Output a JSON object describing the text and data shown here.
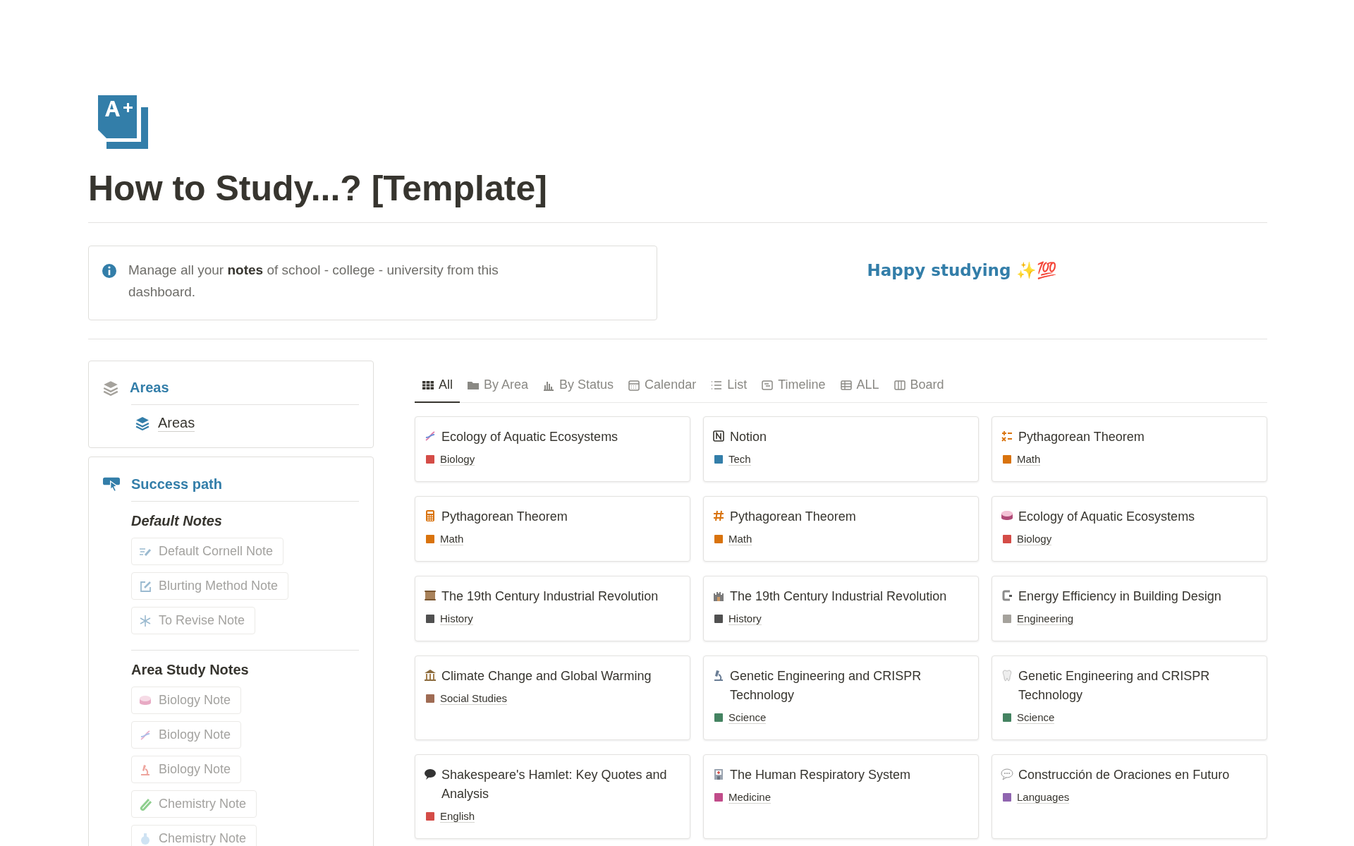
{
  "page": {
    "title": "How to Study...? [Template]"
  },
  "callout": {
    "text": "Manage all your **notes** of school - college - university from this dashboard."
  },
  "tagline": "Happy studying ✨💯",
  "areas_panel": {
    "title": "Areas",
    "items": [
      {
        "label": "Areas"
      }
    ]
  },
  "success_panel": {
    "title": "Success path",
    "sections": [
      {
        "heading": "Default Notes",
        "kind": "italic",
        "items": [
          {
            "label": "Default Cornell Note"
          },
          {
            "label": "Blurting Method Note"
          },
          {
            "label": "To Revise Note"
          }
        ]
      },
      {
        "heading": "Area Study Notes",
        "kind": "plain",
        "items": [
          {
            "label": "Biology Note"
          },
          {
            "label": "Biology Note"
          },
          {
            "label": "Biology Note"
          },
          {
            "label": "Chemistry Note"
          },
          {
            "label": "Chemistry Note"
          }
        ]
      }
    ]
  },
  "tabs": [
    {
      "label": "All",
      "selected": true
    },
    {
      "label": "By Area",
      "selected": false
    },
    {
      "label": "By Status",
      "selected": false
    },
    {
      "label": "Calendar",
      "selected": false
    },
    {
      "label": "List",
      "selected": false
    },
    {
      "label": "Timeline",
      "selected": false
    },
    {
      "label": "ALL",
      "selected": false
    },
    {
      "label": "Board",
      "selected": false
    }
  ],
  "cards": [
    {
      "title": "Ecology of Aquatic Ecosystems",
      "tag": "Biology",
      "color": "#d44c47"
    },
    {
      "title": "Notion",
      "tag": "Tech",
      "color": "#337ea9"
    },
    {
      "title": "Pythagorean Theorem",
      "tag": "Math",
      "color": "#d9730d"
    },
    {
      "title": "Pythagorean Theorem",
      "tag": "Math",
      "color": "#d9730d"
    },
    {
      "title": "Pythagorean Theorem",
      "tag": "Math",
      "color": "#d9730d"
    },
    {
      "title": "Ecology of Aquatic Ecosystems",
      "tag": "Biology",
      "color": "#d44c47"
    },
    {
      "title": "The 19th Century Industrial Revolution",
      "tag": "History",
      "color": "#505050"
    },
    {
      "title": "The 19th Century Industrial Revolution",
      "tag": "History",
      "color": "#505050"
    },
    {
      "title": "Energy Efficiency in Building Design",
      "tag": "Engineering",
      "color": "#a5a29c"
    },
    {
      "title": "Climate Change and Global Warming",
      "tag": "Social Studies",
      "color": "#9f6b53"
    },
    {
      "title": "Genetic Engineering and CRISPR Technology",
      "tag": "Science",
      "color": "#448361"
    },
    {
      "title": "Genetic Engineering and CRISPR Technology",
      "tag": "Science",
      "color": "#448361"
    },
    {
      "title": "Shakespeare's Hamlet: Key Quotes and Analysis",
      "tag": "English",
      "color": "#d44c47"
    },
    {
      "title": "The Human Respiratory System",
      "tag": "Medicine",
      "color": "#c14c8a"
    },
    {
      "title": "Construcción de Oraciones en Futuro",
      "tag": "Languages",
      "color": "#9065b0"
    }
  ]
}
